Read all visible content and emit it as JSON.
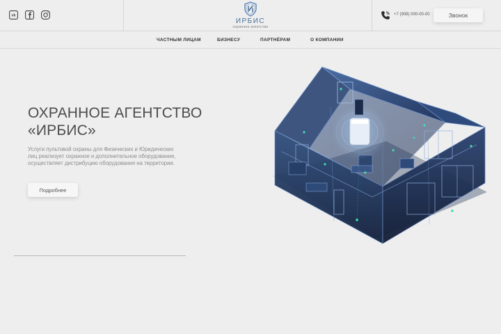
{
  "header": {
    "social": [
      {
        "icon": "vk-icon"
      },
      {
        "icon": "facebook-icon"
      },
      {
        "icon": "instagram-icon"
      }
    ],
    "logo": {
      "title": "ИРБИС",
      "subtitle": "охранное агентство",
      "icon": "shield-icon"
    },
    "phone": "+7 (908) 000-00-00",
    "call_button": "Звонок"
  },
  "nav": {
    "items": [
      "ЧАСТНЫМ ЛИЦАМ",
      "БИЗНЕСУ",
      "ПАРТНЁРАМ",
      "О КОМПАНИИ"
    ]
  },
  "hero": {
    "title_line1": "ОХРАННОЕ АГЕНТСТВО",
    "title_line2": "«ИРБИС»",
    "description": "Услуги пультовой охраны для Физических и Юридических лиц реализует охранное и дополнительное оборудование, осуществляет дистрибуцию оборудования на территории.",
    "more_button": "Подробнее"
  },
  "colors": {
    "background": "#eeeeee",
    "logo_blue": "#4a6f9a",
    "house_dark": "#1c2c4e",
    "house_mid": "#3a5a8c",
    "sensor_green": "#3fe0b0"
  }
}
